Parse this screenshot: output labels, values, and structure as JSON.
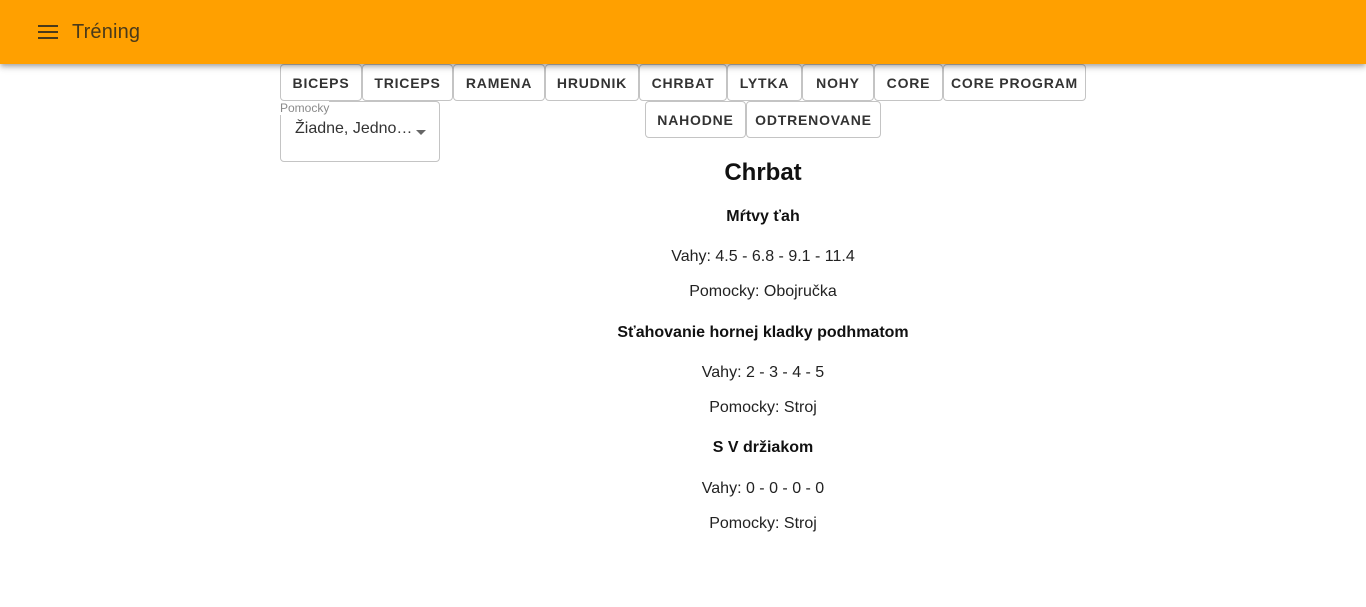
{
  "appbar": {
    "title": "Tréning",
    "menu_icon": "menu-icon"
  },
  "categories": [
    {
      "label": "BICEPS"
    },
    {
      "label": "TRICEPS"
    },
    {
      "label": "RAMENA"
    },
    {
      "label": "HRUDNIK"
    },
    {
      "label": "CHRBAT"
    },
    {
      "label": "LYTKA"
    },
    {
      "label": "NOHY"
    },
    {
      "label": "CORE"
    },
    {
      "label": "CORE PROGRAM"
    },
    {
      "label": "NAHODNE"
    },
    {
      "label": "ODTRENOVANE"
    }
  ],
  "filter": {
    "label": "Pomocky",
    "value": "Žiadne, Jedno…"
  },
  "section": {
    "title": "Chrbat",
    "exercises": [
      {
        "name": "Mŕtvy ťah",
        "weights": "Vahy: 4.5 - 6.8 - 9.1 - 11.4",
        "tools": "Pomocky: Obojručka"
      },
      {
        "name": "Sťahovanie hornej kladky podhmatom",
        "weights": "Vahy: 2 - 3 - 4 - 5",
        "tools": "Pomocky: Stroj"
      },
      {
        "name": "S V držiakom",
        "weights": "Vahy: 0 - 0 - 0 - 0",
        "tools": "Pomocky: Stroj"
      }
    ]
  },
  "colors": {
    "appbar": "#ffa000"
  }
}
